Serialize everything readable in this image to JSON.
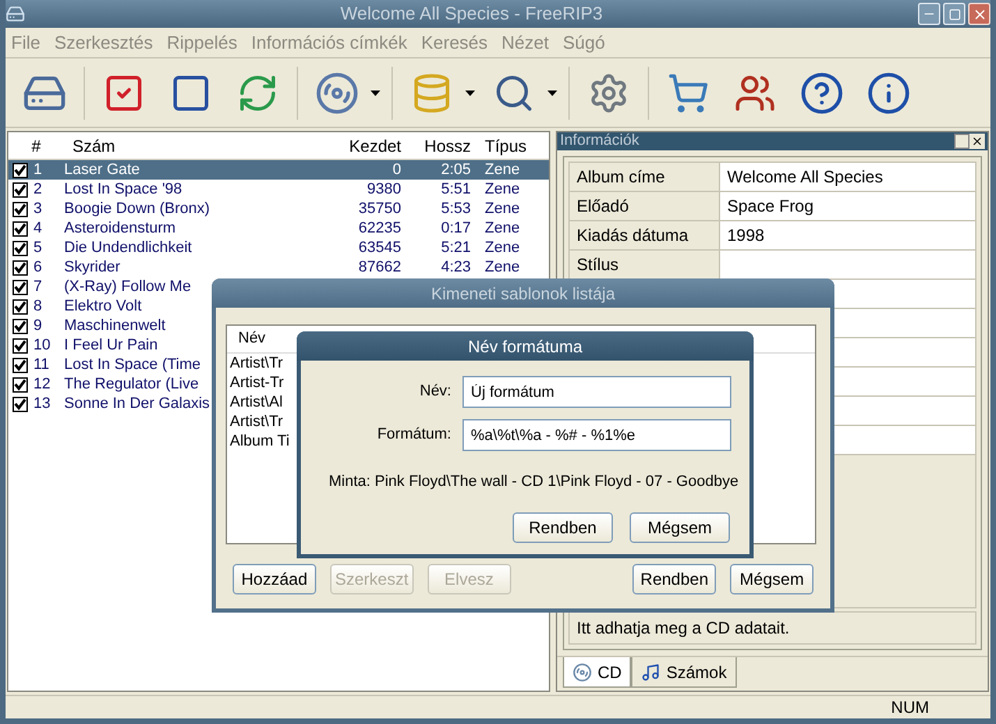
{
  "window": {
    "title": "Welcome All Species - FreeRIP3"
  },
  "menu": [
    "File",
    "Szerkesztés",
    "Rippelés",
    "Információs címkék",
    "Keresés",
    "Nézet",
    "Súgó"
  ],
  "tracks": {
    "columns": [
      "#",
      "Szám",
      "Kezdet",
      "Hossz",
      "Típus"
    ],
    "rows": [
      {
        "number": "1",
        "title": "Laser Gate",
        "start": "0",
        "length": "2:05",
        "type": "Zene",
        "checked": true,
        "selected": true
      },
      {
        "number": "2",
        "title": "Lost In Space '98",
        "start": "9380",
        "length": "5:51",
        "type": "Zene",
        "checked": true,
        "selected": false
      },
      {
        "number": "3",
        "title": "Boogie Down (Bronx)",
        "start": "35750",
        "length": "5:53",
        "type": "Zene",
        "checked": true,
        "selected": false
      },
      {
        "number": "4",
        "title": "Asteroidensturm",
        "start": "62235",
        "length": "0:17",
        "type": "Zene",
        "checked": true,
        "selected": false
      },
      {
        "number": "5",
        "title": "Die Undendlichkeit",
        "start": "63545",
        "length": "5:21",
        "type": "Zene",
        "checked": true,
        "selected": false
      },
      {
        "number": "6",
        "title": "Skyrider",
        "start": "87662",
        "length": "4:23",
        "type": "Zene",
        "checked": true,
        "selected": false
      },
      {
        "number": "7",
        "title": "(X-Ray) Follow Me",
        "checked": true,
        "selected": false
      },
      {
        "number": "8",
        "title": "Elektro Volt",
        "checked": true,
        "selected": false
      },
      {
        "number": "9",
        "title": "Maschinenwelt",
        "checked": true,
        "selected": false
      },
      {
        "number": "10",
        "title": "I Feel Ur Pain",
        "checked": true,
        "selected": false
      },
      {
        "number": "11",
        "title": "Lost In Space (Time",
        "checked": true,
        "selected": false
      },
      {
        "number": "12",
        "title": "The Regulator (Live",
        "checked": true,
        "selected": false
      },
      {
        "number": "13",
        "title": "Sonne In Der Galaxis",
        "checked": true,
        "selected": false
      }
    ]
  },
  "info_panel": {
    "title": "Információk",
    "fields": [
      {
        "label": "Album címe",
        "value": "Welcome All Species"
      },
      {
        "label": "Előadó",
        "value": "Space Frog"
      },
      {
        "label": "Kiadás dátuma",
        "value": "1998"
      },
      {
        "label": "Stílus"
      }
    ],
    "hint": "Itt adhatja meg a CD adatait.",
    "tabs": [
      {
        "label": "CD",
        "selected": true
      },
      {
        "label": "Számok",
        "selected": false
      }
    ]
  },
  "status_bar": {
    "indicator": "NUM"
  },
  "templates_dialog": {
    "title": "Kimeneti sablonok listája",
    "column": "Név",
    "items": [
      "Artist\\Tr",
      "Artist-Tr",
      "Artist\\Al",
      "Artist\\Tr",
      "Album Ti"
    ],
    "buttons": [
      {
        "label": "Hozzáad",
        "disabled": false
      },
      {
        "label": "Szerkeszt",
        "disabled": true
      },
      {
        "label": "Elvesz",
        "disabled": true
      },
      {
        "label": "Rendben",
        "disabled": false
      },
      {
        "label": "Mégsem",
        "disabled": false
      }
    ]
  },
  "format_dialog": {
    "title": "Név formátuma",
    "fields": [
      {
        "label": "Név:",
        "value": "Új formátum"
      },
      {
        "label": "Formátum:",
        "value": "%a\\%t\\%a - %# - %1%e"
      }
    ],
    "sample": "Minta: Pink Floyd\\The wall - CD 1\\Pink Floyd - 07 - Goodbye",
    "buttons": [
      {
        "label": "Rendben",
        "disabled": false
      },
      {
        "label": "Mégsem",
        "disabled": false
      }
    ]
  }
}
